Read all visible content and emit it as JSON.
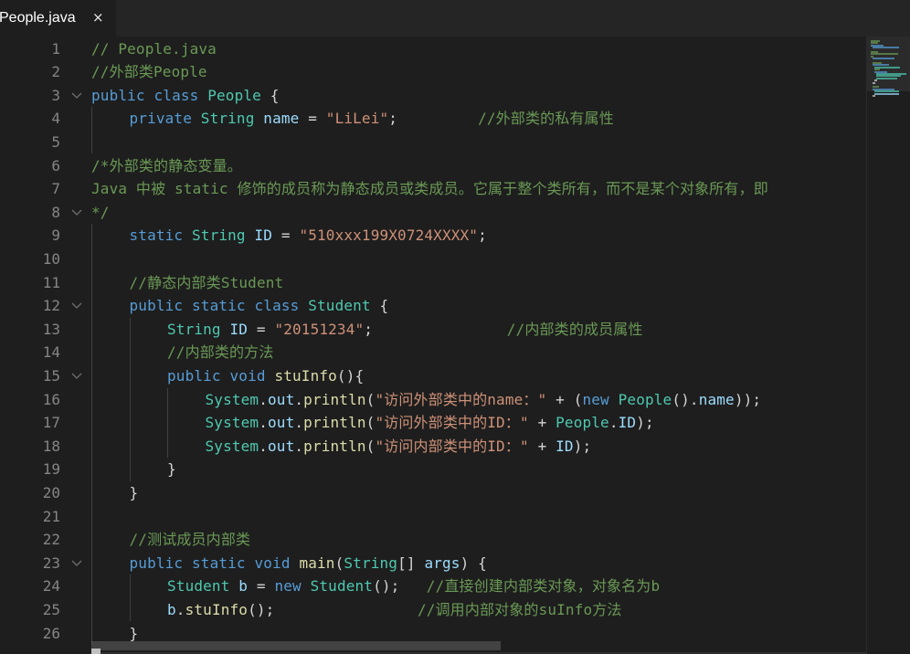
{
  "tab": {
    "label": "People.java",
    "close_glyph": "×"
  },
  "colors": {
    "keyword": "#569cd6",
    "type": "#4ec9b0",
    "variable": "#9cdcfe",
    "string": "#ce9178",
    "comment": "#6a9955",
    "function": "#dcdcaa",
    "plain": "#d4d4d4"
  },
  "lines": [
    {
      "n": "1",
      "fold": false,
      "indent": 0,
      "tokens": [
        {
          "t": "// People.java",
          "c": "cm"
        }
      ]
    },
    {
      "n": "2",
      "fold": false,
      "indent": 0,
      "tokens": [
        {
          "t": "//外部类People",
          "c": "cm"
        }
      ]
    },
    {
      "n": "3",
      "fold": true,
      "indent": 0,
      "tokens": [
        {
          "t": "public",
          "c": "kw"
        },
        {
          "t": " ",
          "c": "pl"
        },
        {
          "t": "class",
          "c": "kw"
        },
        {
          "t": " ",
          "c": "pl"
        },
        {
          "t": "People",
          "c": "ty"
        },
        {
          "t": " {",
          "c": "pl"
        }
      ]
    },
    {
      "n": "4",
      "fold": false,
      "indent": 1,
      "tokens": [
        {
          "t": "private",
          "c": "kw"
        },
        {
          "t": " ",
          "c": "pl"
        },
        {
          "t": "String",
          "c": "ty"
        },
        {
          "t": " ",
          "c": "pl"
        },
        {
          "t": "name",
          "c": "va"
        },
        {
          "t": " = ",
          "c": "pl"
        },
        {
          "t": "\"LiLei\"",
          "c": "st"
        },
        {
          "t": ";         ",
          "c": "pl"
        },
        {
          "t": "//外部类的私有属性",
          "c": "cm"
        }
      ]
    },
    {
      "n": "5",
      "fold": false,
      "indent": 0,
      "tokens": []
    },
    {
      "n": "6",
      "fold": false,
      "indent": 0,
      "tokens": [
        {
          "t": "/*外部类的静态变量。",
          "c": "cm"
        }
      ]
    },
    {
      "n": "7",
      "fold": false,
      "indent": 0,
      "tokens": [
        {
          "t": "Java 中被 static 修饰的成员称为静态成员或类成员。它属于整个类所有，而不是某个对象所有，即",
          "c": "cm"
        }
      ]
    },
    {
      "n": "8",
      "fold": true,
      "indent": 0,
      "tokens": [
        {
          "t": "*/",
          "c": "cm"
        }
      ]
    },
    {
      "n": "9",
      "fold": false,
      "indent": 1,
      "tokens": [
        {
          "t": "static",
          "c": "kw"
        },
        {
          "t": " ",
          "c": "pl"
        },
        {
          "t": "String",
          "c": "ty"
        },
        {
          "t": " ",
          "c": "pl"
        },
        {
          "t": "ID",
          "c": "va"
        },
        {
          "t": " = ",
          "c": "pl"
        },
        {
          "t": "\"510xxx199X0724XXXX\"",
          "c": "st"
        },
        {
          "t": ";",
          "c": "pl"
        }
      ]
    },
    {
      "n": "10",
      "fold": false,
      "indent": 0,
      "tokens": []
    },
    {
      "n": "11",
      "fold": false,
      "indent": 1,
      "tokens": [
        {
          "t": "//静态内部类Student",
          "c": "cm"
        }
      ]
    },
    {
      "n": "12",
      "fold": true,
      "indent": 1,
      "tokens": [
        {
          "t": "public",
          "c": "kw"
        },
        {
          "t": " ",
          "c": "pl"
        },
        {
          "t": "static",
          "c": "kw"
        },
        {
          "t": " ",
          "c": "pl"
        },
        {
          "t": "class",
          "c": "kw"
        },
        {
          "t": " ",
          "c": "pl"
        },
        {
          "t": "Student",
          "c": "ty"
        },
        {
          "t": " {",
          "c": "pl"
        }
      ]
    },
    {
      "n": "13",
      "fold": false,
      "indent": 2,
      "tokens": [
        {
          "t": "String",
          "c": "ty"
        },
        {
          "t": " ",
          "c": "pl"
        },
        {
          "t": "ID",
          "c": "va"
        },
        {
          "t": " = ",
          "c": "pl"
        },
        {
          "t": "\"20151234\"",
          "c": "st"
        },
        {
          "t": ";               ",
          "c": "pl"
        },
        {
          "t": "//内部类的成员属性",
          "c": "cm"
        }
      ]
    },
    {
      "n": "14",
      "fold": false,
      "indent": 2,
      "tokens": [
        {
          "t": "//内部类的方法",
          "c": "cm"
        }
      ]
    },
    {
      "n": "15",
      "fold": true,
      "indent": 2,
      "tokens": [
        {
          "t": "public",
          "c": "kw"
        },
        {
          "t": " ",
          "c": "pl"
        },
        {
          "t": "void",
          "c": "kw"
        },
        {
          "t": " ",
          "c": "pl"
        },
        {
          "t": "stuInfo",
          "c": "fn"
        },
        {
          "t": "(){",
          "c": "pl"
        }
      ]
    },
    {
      "n": "16",
      "fold": false,
      "indent": 3,
      "tokens": [
        {
          "t": "System",
          "c": "ty"
        },
        {
          "t": ".",
          "c": "pl"
        },
        {
          "t": "out",
          "c": "va"
        },
        {
          "t": ".",
          "c": "pl"
        },
        {
          "t": "println",
          "c": "fn"
        },
        {
          "t": "(",
          "c": "pl"
        },
        {
          "t": "\"访问外部类中的name：\"",
          "c": "st"
        },
        {
          "t": " + (",
          "c": "pl"
        },
        {
          "t": "new",
          "c": "kw"
        },
        {
          "t": " ",
          "c": "pl"
        },
        {
          "t": "People",
          "c": "ty"
        },
        {
          "t": "().",
          "c": "pl"
        },
        {
          "t": "name",
          "c": "va"
        },
        {
          "t": "));",
          "c": "pl"
        }
      ]
    },
    {
      "n": "17",
      "fold": false,
      "indent": 3,
      "tokens": [
        {
          "t": "System",
          "c": "ty"
        },
        {
          "t": ".",
          "c": "pl"
        },
        {
          "t": "out",
          "c": "va"
        },
        {
          "t": ".",
          "c": "pl"
        },
        {
          "t": "println",
          "c": "fn"
        },
        {
          "t": "(",
          "c": "pl"
        },
        {
          "t": "\"访问外部类中的ID：\"",
          "c": "st"
        },
        {
          "t": " + ",
          "c": "pl"
        },
        {
          "t": "People",
          "c": "ty"
        },
        {
          "t": ".",
          "c": "pl"
        },
        {
          "t": "ID",
          "c": "va"
        },
        {
          "t": ");",
          "c": "pl"
        }
      ]
    },
    {
      "n": "18",
      "fold": false,
      "indent": 3,
      "tokens": [
        {
          "t": "System",
          "c": "ty"
        },
        {
          "t": ".",
          "c": "pl"
        },
        {
          "t": "out",
          "c": "va"
        },
        {
          "t": ".",
          "c": "pl"
        },
        {
          "t": "println",
          "c": "fn"
        },
        {
          "t": "(",
          "c": "pl"
        },
        {
          "t": "\"访问内部类中的ID：\"",
          "c": "st"
        },
        {
          "t": " + ",
          "c": "pl"
        },
        {
          "t": "ID",
          "c": "va"
        },
        {
          "t": ");",
          "c": "pl"
        }
      ]
    },
    {
      "n": "19",
      "fold": false,
      "indent": 2,
      "tokens": [
        {
          "t": "}",
          "c": "pl"
        }
      ]
    },
    {
      "n": "20",
      "fold": false,
      "indent": 1,
      "tokens": [
        {
          "t": "}",
          "c": "pl"
        }
      ]
    },
    {
      "n": "21",
      "fold": false,
      "indent": 0,
      "tokens": []
    },
    {
      "n": "22",
      "fold": false,
      "indent": 1,
      "tokens": [
        {
          "t": "//测试成员内部类",
          "c": "cm"
        }
      ]
    },
    {
      "n": "23",
      "fold": true,
      "indent": 1,
      "tokens": [
        {
          "t": "public",
          "c": "kw"
        },
        {
          "t": " ",
          "c": "pl"
        },
        {
          "t": "static",
          "c": "kw"
        },
        {
          "t": " ",
          "c": "pl"
        },
        {
          "t": "void",
          "c": "kw"
        },
        {
          "t": " ",
          "c": "pl"
        },
        {
          "t": "main",
          "c": "fn"
        },
        {
          "t": "(",
          "c": "pl"
        },
        {
          "t": "String",
          "c": "ty"
        },
        {
          "t": "[] ",
          "c": "pl"
        },
        {
          "t": "args",
          "c": "va"
        },
        {
          "t": ") {",
          "c": "pl"
        }
      ]
    },
    {
      "n": "24",
      "fold": false,
      "indent": 2,
      "tokens": [
        {
          "t": "Student",
          "c": "ty"
        },
        {
          "t": " ",
          "c": "pl"
        },
        {
          "t": "b",
          "c": "va"
        },
        {
          "t": " = ",
          "c": "pl"
        },
        {
          "t": "new",
          "c": "kw"
        },
        {
          "t": " ",
          "c": "pl"
        },
        {
          "t": "Student",
          "c": "ty"
        },
        {
          "t": "();   ",
          "c": "pl"
        },
        {
          "t": "//直接创建内部类对象，对象名为b",
          "c": "cm"
        }
      ]
    },
    {
      "n": "25",
      "fold": false,
      "indent": 2,
      "tokens": [
        {
          "t": "b",
          "c": "va"
        },
        {
          "t": ".",
          "c": "pl"
        },
        {
          "t": "stuInfo",
          "c": "fn"
        },
        {
          "t": "();                ",
          "c": "pl"
        },
        {
          "t": "//调用内部对象的suInfo方法",
          "c": "cm"
        }
      ]
    },
    {
      "n": "26",
      "fold": false,
      "indent": 1,
      "tokens": [
        {
          "t": "}",
          "c": "pl"
        }
      ]
    }
  ]
}
